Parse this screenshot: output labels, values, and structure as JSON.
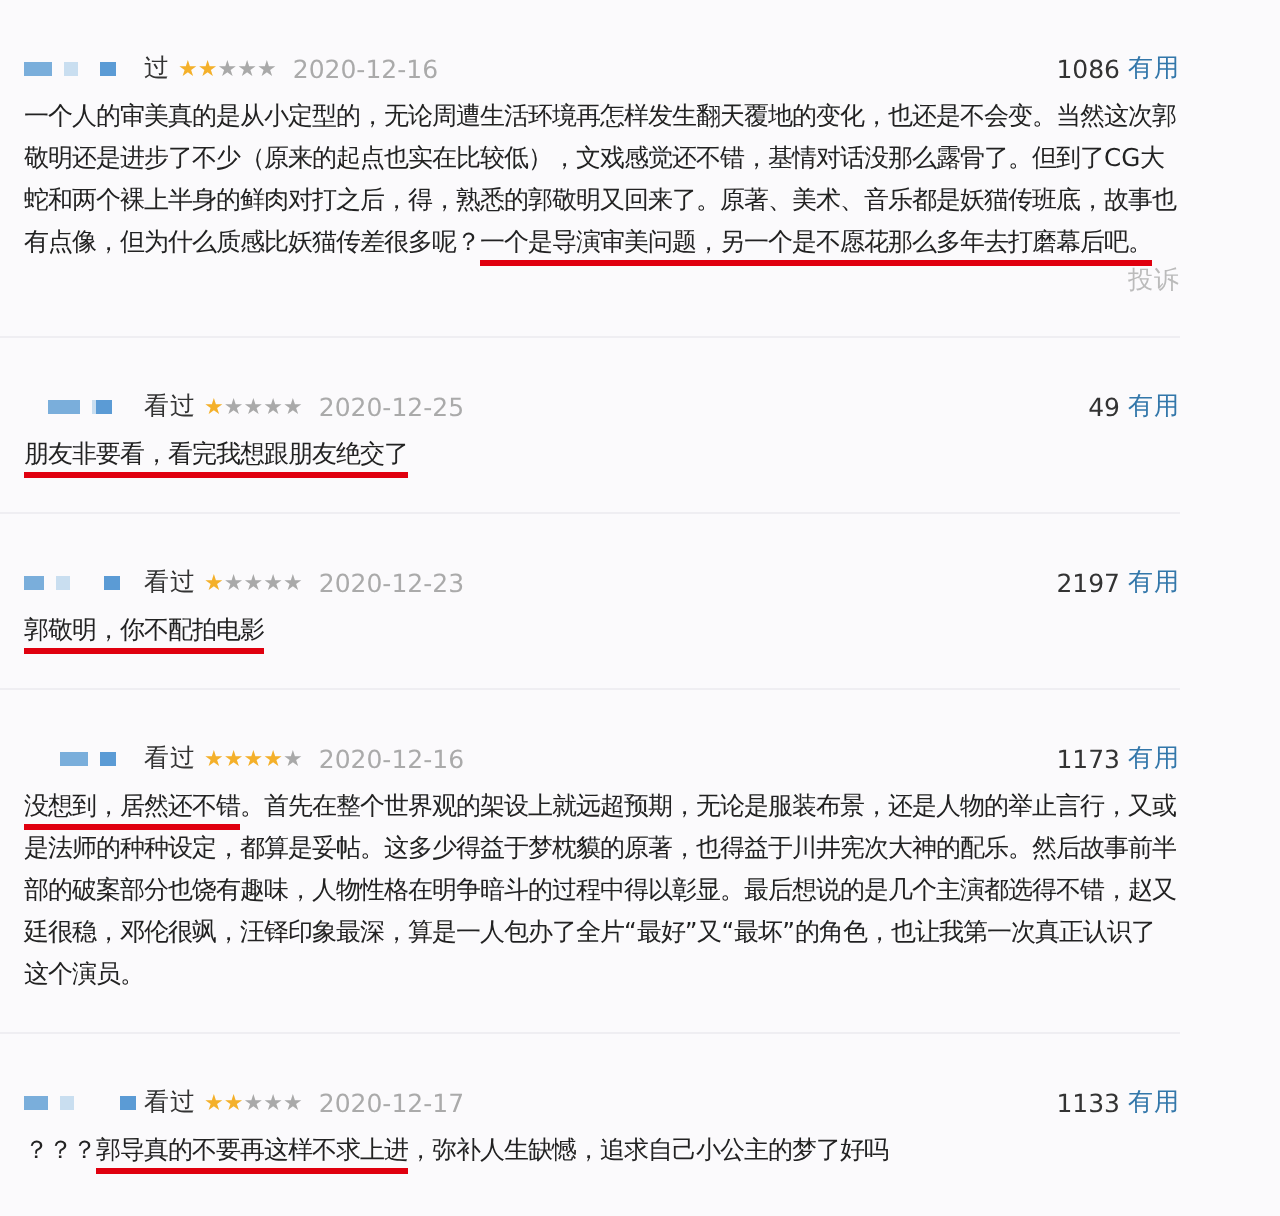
{
  "reviews": [
    {
      "status": "过",
      "stars": 2,
      "date": "2020-12-16",
      "votes": "1086",
      "vote_label": "有用",
      "body": [
        {
          "text": "一个人的审美真的是从小定型的，无论周遭生活环境再怎样发生翻天覆地的变化，也还是不会变。当然这次郭敬明还是进步了不少（原来的起点也实在比较低），文戏感觉还不错，基情对话没那么露骨了。但到了CG大蛇和两个裸上半身的鲜肉对打之后，得，熟悉的郭敬明又回来了。原著、美术、音乐都是妖猫传班底，故事也有点像，但为什么质感比妖猫传差很多呢？",
          "underlined": false
        },
        {
          "text": "一个是导演审美问题，另一个是不愿花那么多年去打磨幕后吧。",
          "underlined": true
        }
      ],
      "report": "投诉"
    },
    {
      "status": "看过",
      "stars": 1,
      "date": "2020-12-25",
      "votes": "49",
      "vote_label": "有用",
      "body": [
        {
          "text": "朋友非要看，看完我想跟朋友绝交了",
          "underlined": true
        }
      ]
    },
    {
      "status": "看过",
      "stars": 1,
      "date": "2020-12-23",
      "votes": "2197",
      "vote_label": "有用",
      "body": [
        {
          "text": "郭敬明，你不配拍电影",
          "underlined": true
        }
      ]
    },
    {
      "status": "看过",
      "stars": 4,
      "date": "2020-12-16",
      "votes": "1173",
      "vote_label": "有用",
      "body": [
        {
          "text": "没想到，居然还不错",
          "underlined": true
        },
        {
          "text": "。首先在整个世界观的架设上就远超预期，无论是服装布景，还是人物的举止言行，又或是法师的种种设定，都算是妥帖。这多少得益于梦枕貘的原著，也得益于川井宪次大神的配乐。然后故事前半部的破案部分也饶有趣味，人物性格在明争暗斗的过程中得以彰显。最后想说的是几个主演都选得不错，赵又廷很稳，邓伦很飒，汪铎印象最深，算是一人包办了全片“最好”又“最坏”的角色，也让我第一次真正认识了这个演员。",
          "underlined": false
        }
      ]
    },
    {
      "status": "看过",
      "stars": 2,
      "date": "2020-12-17",
      "votes": "1133",
      "vote_label": "有用",
      "body": [
        {
          "text": "？？？",
          "underlined": false
        },
        {
          "text": "郭导真的不要再这样不求上进",
          "underlined": true
        },
        {
          "text": "，弥补人生缺憾，追求自己小公主的梦了好吗",
          "underlined": false
        }
      ]
    }
  ]
}
